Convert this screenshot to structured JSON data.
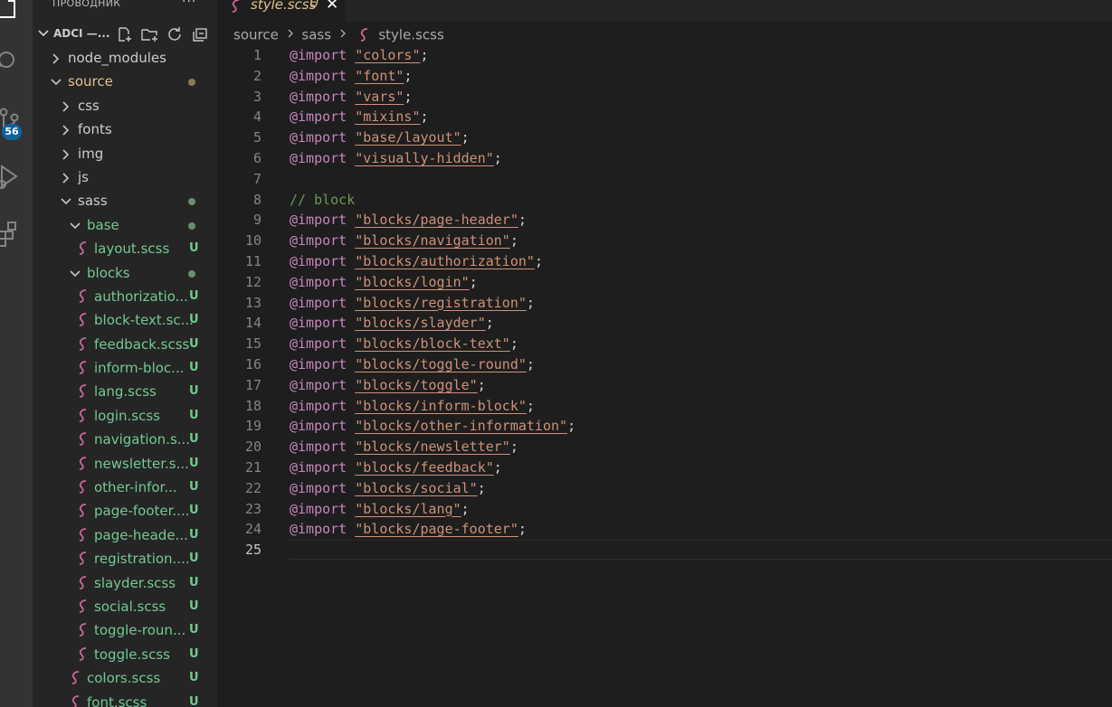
{
  "explorer": {
    "title": "ПРОВОДНИК",
    "more": "···",
    "root_name": "ADCI —...",
    "items": [
      {
        "label": "node_modules",
        "kind": "folder",
        "depth": 1,
        "open": false,
        "status": ""
      },
      {
        "label": "source",
        "kind": "folder",
        "depth": 1,
        "open": true,
        "status": "dot-mod",
        "color": "#e2c08d"
      },
      {
        "label": "css",
        "kind": "folder",
        "depth": 2,
        "open": false,
        "status": ""
      },
      {
        "label": "fonts",
        "kind": "folder",
        "depth": 2,
        "open": false,
        "status": ""
      },
      {
        "label": "img",
        "kind": "folder",
        "depth": 2,
        "open": false,
        "status": ""
      },
      {
        "label": "js",
        "kind": "folder",
        "depth": 2,
        "open": false,
        "status": ""
      },
      {
        "label": "sass",
        "kind": "folder",
        "depth": 2,
        "open": true,
        "status": "dot"
      },
      {
        "label": "base",
        "kind": "folder",
        "depth": 3,
        "open": true,
        "status": "dot",
        "color": "#73c991"
      },
      {
        "label": "layout.scss",
        "kind": "file",
        "depth": 4,
        "status": "U",
        "color": "#73c991"
      },
      {
        "label": "blocks",
        "kind": "folder",
        "depth": 3,
        "open": true,
        "status": "dot",
        "color": "#73c991"
      },
      {
        "label": "authorizatio...",
        "kind": "file",
        "depth": 4,
        "status": "U",
        "color": "#73c991"
      },
      {
        "label": "block-text.sc...",
        "kind": "file",
        "depth": 4,
        "status": "U",
        "color": "#73c991"
      },
      {
        "label": "feedback.scss",
        "kind": "file",
        "depth": 4,
        "status": "U",
        "color": "#73c991"
      },
      {
        "label": "inform-bloc...",
        "kind": "file",
        "depth": 4,
        "status": "U",
        "color": "#73c991"
      },
      {
        "label": "lang.scss",
        "kind": "file",
        "depth": 4,
        "status": "U",
        "color": "#73c991"
      },
      {
        "label": "login.scss",
        "kind": "file",
        "depth": 4,
        "status": "U",
        "color": "#73c991"
      },
      {
        "label": "navigation.s...",
        "kind": "file",
        "depth": 4,
        "status": "U",
        "color": "#73c991"
      },
      {
        "label": "newsletter.s...",
        "kind": "file",
        "depth": 4,
        "status": "U",
        "color": "#73c991"
      },
      {
        "label": "other-infor...",
        "kind": "file",
        "depth": 4,
        "status": "U",
        "color": "#73c991"
      },
      {
        "label": "page-footer....",
        "kind": "file",
        "depth": 4,
        "status": "U",
        "color": "#73c991"
      },
      {
        "label": "page-heade...",
        "kind": "file",
        "depth": 4,
        "status": "U",
        "color": "#73c991"
      },
      {
        "label": "registration....",
        "kind": "file",
        "depth": 4,
        "status": "U",
        "color": "#73c991"
      },
      {
        "label": "slayder.scss",
        "kind": "file",
        "depth": 4,
        "status": "U",
        "color": "#73c991"
      },
      {
        "label": "social.scss",
        "kind": "file",
        "depth": 4,
        "status": "U",
        "color": "#73c991"
      },
      {
        "label": "toggle-roun...",
        "kind": "file",
        "depth": 4,
        "status": "U",
        "color": "#73c991"
      },
      {
        "label": "toggle.scss",
        "kind": "file",
        "depth": 4,
        "status": "U",
        "color": "#73c991"
      },
      {
        "label": "colors.scss",
        "kind": "file",
        "depth": 3,
        "status": "U",
        "color": "#73c991"
      },
      {
        "label": "font.scss",
        "kind": "file",
        "depth": 3,
        "status": "U",
        "color": "#73c991"
      }
    ]
  },
  "activity": {
    "scm_badge": "56"
  },
  "tab": {
    "name": "style.scss",
    "status": "U",
    "close": "✕"
  },
  "breadcrumb": [
    "source",
    "sass",
    "style.scss"
  ],
  "code": [
    {
      "n": "1",
      "kw": "@import",
      "str": "\"colors\"",
      "end": ";"
    },
    {
      "n": "2",
      "kw": "@import",
      "str": "\"font\"",
      "end": ";"
    },
    {
      "n": "3",
      "kw": "@import",
      "str": "\"vars\"",
      "end": ";"
    },
    {
      "n": "4",
      "kw": "@import",
      "str": "\"mixins\"",
      "end": ";"
    },
    {
      "n": "5",
      "kw": "@import",
      "str": "\"base/layout\"",
      "end": ";"
    },
    {
      "n": "6",
      "kw": "@import",
      "str": "\"visually-hidden\"",
      "end": ";"
    },
    {
      "n": "7"
    },
    {
      "n": "8",
      "comment": "// block"
    },
    {
      "n": "9",
      "kw": "@import",
      "str": "\"blocks/page-header\"",
      "end": ";"
    },
    {
      "n": "10",
      "kw": "@import",
      "str": "\"blocks/navigation\"",
      "end": ";"
    },
    {
      "n": "11",
      "kw": "@import",
      "str": "\"blocks/authorization\"",
      "end": ";"
    },
    {
      "n": "12",
      "kw": "@import",
      "str": "\"blocks/login\"",
      "end": ";"
    },
    {
      "n": "13",
      "kw": "@import",
      "str": "\"blocks/registration\"",
      "end": ";"
    },
    {
      "n": "14",
      "kw": "@import",
      "str": "\"blocks/slayder\"",
      "end": ";"
    },
    {
      "n": "15",
      "kw": "@import",
      "str": "\"blocks/block-text\"",
      "end": ";"
    },
    {
      "n": "16",
      "kw": "@import",
      "str": "\"blocks/toggle-round\"",
      "end": ";"
    },
    {
      "n": "17",
      "kw": "@import",
      "str": "\"blocks/toggle\"",
      "end": ";"
    },
    {
      "n": "18",
      "kw": "@import",
      "str": "\"blocks/inform-block\"",
      "end": ";"
    },
    {
      "n": "19",
      "kw": "@import",
      "str": "\"blocks/other-information\"",
      "end": ";"
    },
    {
      "n": "20",
      "kw": "@import",
      "str": "\"blocks/newsletter\"",
      "end": ";"
    },
    {
      "n": "21",
      "kw": "@import",
      "str": "\"blocks/feedback\"",
      "end": ";"
    },
    {
      "n": "22",
      "kw": "@import",
      "str": "\"blocks/social\"",
      "end": ";"
    },
    {
      "n": "23",
      "kw": "@import",
      "str": "\"blocks/lang\"",
      "end": ";"
    },
    {
      "n": "24",
      "kw": "@import",
      "str": "\"blocks/page-footer\"",
      "end": ";"
    },
    {
      "n": "25",
      "active": true
    }
  ]
}
